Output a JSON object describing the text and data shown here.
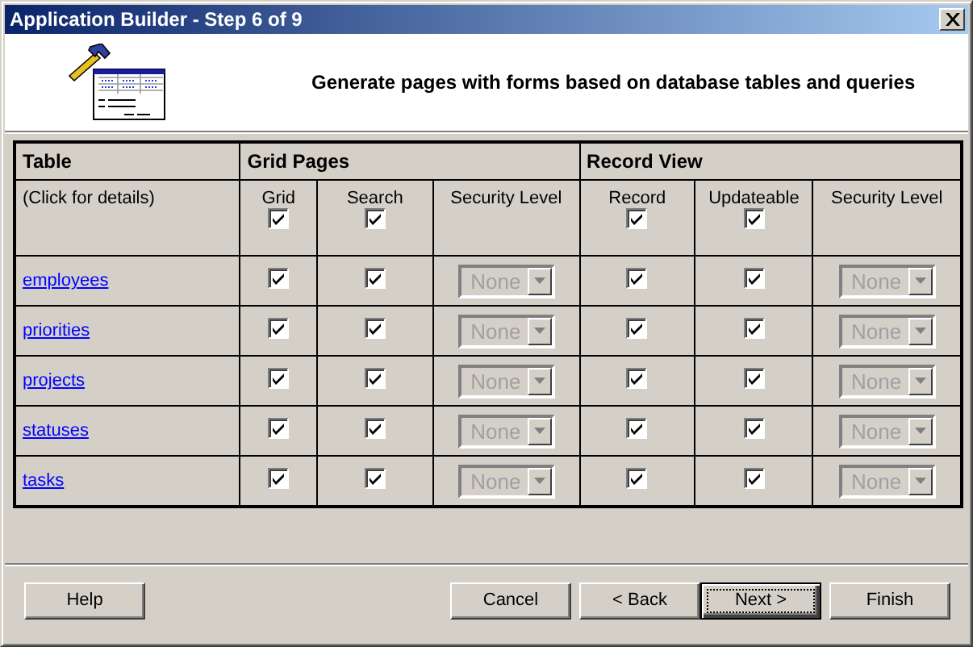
{
  "window": {
    "title": "Application Builder - Step 6 of 9"
  },
  "header": {
    "text": "Generate pages with forms based on database tables and queries"
  },
  "table": {
    "groups": [
      {
        "label": "Table",
        "columns": [
          {
            "label": "(Click for details)",
            "kind": "text"
          }
        ]
      },
      {
        "label": "Grid Pages",
        "columns": [
          {
            "label": "Grid",
            "kind": "check",
            "checked": true
          },
          {
            "label": "Search",
            "kind": "check",
            "checked": true
          },
          {
            "label": "Security Level",
            "kind": "text"
          }
        ]
      },
      {
        "label": "Record View",
        "columns": [
          {
            "label": "Record",
            "kind": "check",
            "checked": true
          },
          {
            "label": "Updateable",
            "kind": "check",
            "checked": true
          },
          {
            "label": "Security Level",
            "kind": "text"
          }
        ]
      }
    ],
    "rows": [
      {
        "cells": [
          {
            "kind": "link",
            "text": "employees"
          },
          {
            "kind": "check",
            "checked": true
          },
          {
            "kind": "check",
            "checked": true
          },
          {
            "kind": "select",
            "value": "None",
            "disabled": true
          },
          {
            "kind": "check",
            "checked": true
          },
          {
            "kind": "check",
            "checked": true
          },
          {
            "kind": "select",
            "value": "None",
            "disabled": true
          }
        ]
      },
      {
        "cells": [
          {
            "kind": "link",
            "text": "priorities"
          },
          {
            "kind": "check",
            "checked": true
          },
          {
            "kind": "check",
            "checked": true
          },
          {
            "kind": "select",
            "value": "None",
            "disabled": true
          },
          {
            "kind": "check",
            "checked": true
          },
          {
            "kind": "check",
            "checked": true
          },
          {
            "kind": "select",
            "value": "None",
            "disabled": true
          }
        ]
      },
      {
        "cells": [
          {
            "kind": "link",
            "text": "projects"
          },
          {
            "kind": "check",
            "checked": true
          },
          {
            "kind": "check",
            "checked": true
          },
          {
            "kind": "select",
            "value": "None",
            "disabled": true
          },
          {
            "kind": "check",
            "checked": true
          },
          {
            "kind": "check",
            "checked": true
          },
          {
            "kind": "select",
            "value": "None",
            "disabled": true
          }
        ]
      },
      {
        "cells": [
          {
            "kind": "link",
            "text": "statuses"
          },
          {
            "kind": "check",
            "checked": true
          },
          {
            "kind": "check",
            "checked": true
          },
          {
            "kind": "select",
            "value": "None",
            "disabled": true
          },
          {
            "kind": "check",
            "checked": true
          },
          {
            "kind": "check",
            "checked": true
          },
          {
            "kind": "select",
            "value": "None",
            "disabled": true
          }
        ]
      },
      {
        "cells": [
          {
            "kind": "link",
            "text": "tasks"
          },
          {
            "kind": "check",
            "checked": true
          },
          {
            "kind": "check",
            "checked": true
          },
          {
            "kind": "select",
            "value": "None",
            "disabled": true
          },
          {
            "kind": "check",
            "checked": true
          },
          {
            "kind": "check",
            "checked": true
          },
          {
            "kind": "select",
            "value": "None",
            "disabled": true
          }
        ]
      }
    ]
  },
  "buttons_left": [
    {
      "label": "Help",
      "default": false
    }
  ],
  "buttons_right": [
    {
      "label": "Cancel",
      "default": false
    },
    {
      "label": "< Back",
      "default": false
    },
    {
      "label": "Next >",
      "default": true
    },
    {
      "label": "Finish",
      "default": false
    }
  ]
}
